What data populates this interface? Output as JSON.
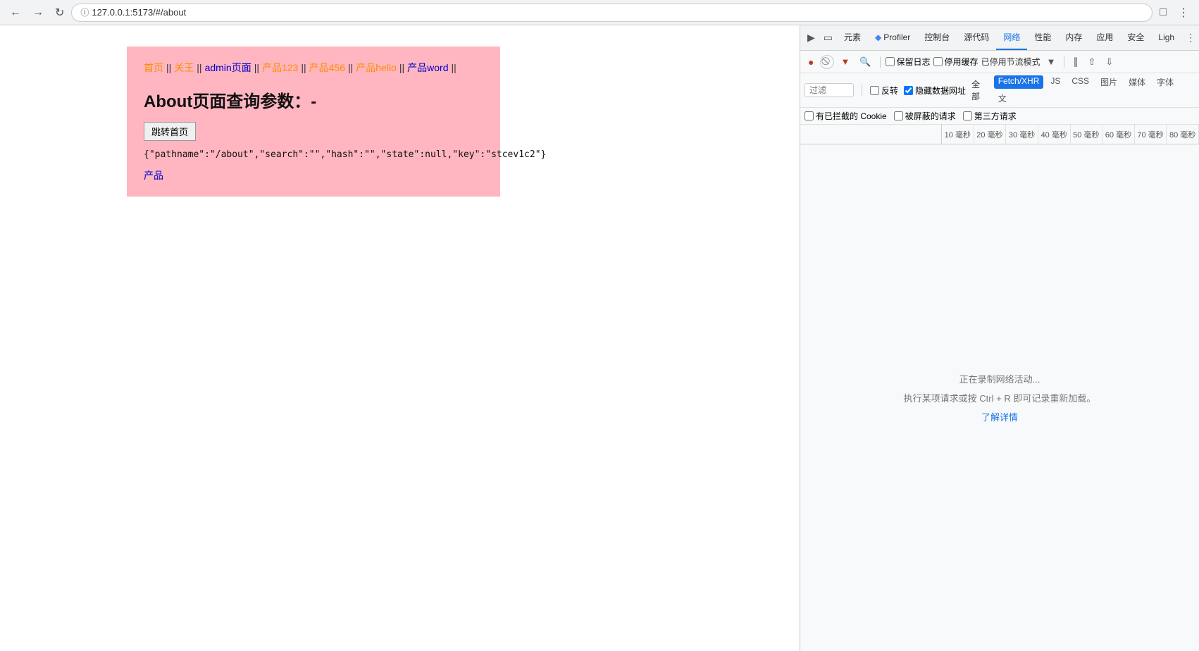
{
  "browser": {
    "url": "127.0.0.1:5173/#/about",
    "url_display": "127.0.0.1:5173/#/about"
  },
  "page": {
    "nav_links": [
      {
        "label": "首页",
        "color": "orange"
      },
      {
        "label": "||",
        "color": "black"
      },
      {
        "label": "关王",
        "color": "orange"
      },
      {
        "label": "||",
        "color": "black"
      },
      {
        "label": "admin页面",
        "color": "blue"
      },
      {
        "label": "||",
        "color": "black"
      },
      {
        "label": "产品123",
        "color": "orange"
      },
      {
        "label": "||",
        "color": "black"
      },
      {
        "label": "产品456",
        "color": "orange"
      },
      {
        "label": "||",
        "color": "black"
      },
      {
        "label": "产品hello",
        "color": "orange"
      },
      {
        "label": "||",
        "color": "black"
      },
      {
        "label": "产品word",
        "color": "blue"
      },
      {
        "label": "||",
        "color": "black"
      }
    ],
    "about_title": "About页面查询参数：-",
    "goto_btn": "跳转首页",
    "json_text": "{\"pathname\":\"/about\",\"search\":\"\",\"hash\":\"\",\"state\":null,\"key\":\"stcev1c2\"}",
    "product_link": "产品"
  },
  "devtools": {
    "tabs": [
      {
        "label": "元素",
        "active": false
      },
      {
        "label": "Profiler",
        "active": false,
        "has_icon": true
      },
      {
        "label": "控制台",
        "active": false
      },
      {
        "label": "源代码",
        "active": false
      },
      {
        "label": "网络",
        "active": true
      },
      {
        "label": "性能",
        "active": false
      },
      {
        "label": "内存",
        "active": false
      },
      {
        "label": "应用",
        "active": false
      },
      {
        "label": "安全",
        "active": false
      },
      {
        "label": "Ligh",
        "active": false
      }
    ],
    "toolbar": {
      "preserve_log": "保留日志",
      "disable_cache": "停用缓存",
      "stream_mode": "已停用节流模式"
    },
    "filter": {
      "placeholder": "过滤",
      "reverse": "反转",
      "hide_data_urls": "隐藏数据网址",
      "all": "全部",
      "types": [
        "Fetch/XHR",
        "JS",
        "CSS",
        "图片",
        "媒体",
        "字体",
        "文"
      ],
      "active_type": "全部"
    },
    "options": {
      "blocked_cookies": "有已拦截的 Cookie",
      "blocked_requests": "被屏蔽的请求",
      "third_party": "第三方请求"
    },
    "timeline_ticks": [
      "10 毫秒",
      "20 毫秒",
      "30 毫秒",
      "40 毫秒",
      "50 毫秒",
      "60 毫秒",
      "70 毫秒",
      "80 毫秒"
    ],
    "network_empty": {
      "recording": "正在录制网络活动...",
      "hint": "执行某项请求或按 Ctrl + R 即可记录重新加载。",
      "learn_link": "了解详情"
    }
  }
}
